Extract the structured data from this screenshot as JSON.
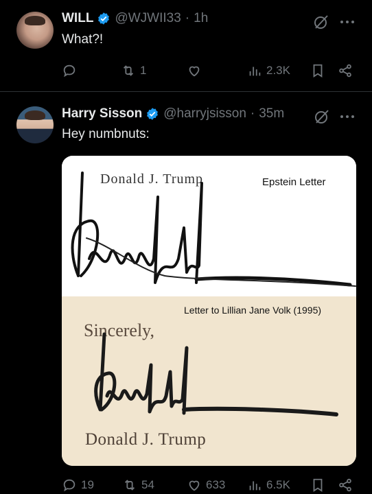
{
  "tweets": [
    {
      "name": "WILL",
      "handle": "@WJWII33",
      "time": "1h",
      "text": "What?!",
      "actions": {
        "replies": "",
        "reposts": "1",
        "likes": "",
        "views": "2.3K"
      }
    },
    {
      "name": "Harry Sisson",
      "handle": "@harryjsisson",
      "time": "35m",
      "text": "Hey numbnuts:",
      "media": {
        "top_typed_name": "Donald J. Trump",
        "top_caption": "Epstein Letter",
        "bottom_caption": "Letter to Lillian Jane Volk (1995)",
        "bottom_closing": "Sincerely,",
        "bottom_printed_name": "Donald J. Trump"
      },
      "actions": {
        "replies": "19",
        "reposts": "54",
        "likes": "633",
        "views": "6.5K"
      }
    }
  ],
  "colors": {
    "background": "#000000",
    "text": "#e7e9ea",
    "muted": "#71767b",
    "verified": "#1d9bf0",
    "divider": "#2f3336"
  }
}
